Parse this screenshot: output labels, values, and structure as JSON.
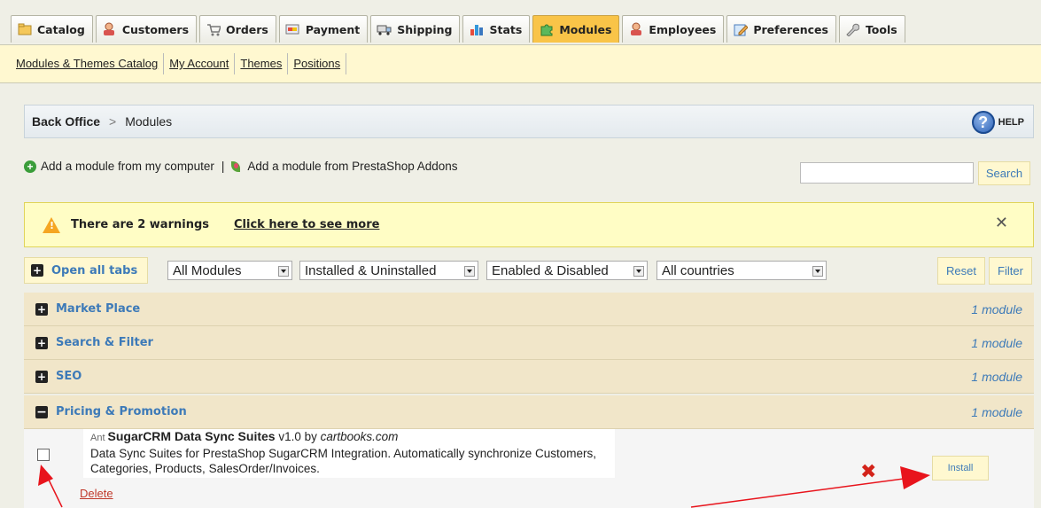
{
  "tabs": [
    {
      "label": "Catalog",
      "icon": "folder-icon"
    },
    {
      "label": "Customers",
      "icon": "customer-icon"
    },
    {
      "label": "Orders",
      "icon": "cart-icon"
    },
    {
      "label": "Payment",
      "icon": "payment-icon"
    },
    {
      "label": "Shipping",
      "icon": "truck-icon"
    },
    {
      "label": "Stats",
      "icon": "bar-chart-icon"
    },
    {
      "label": "Modules",
      "icon": "puzzle-icon",
      "active": true
    },
    {
      "label": "Employees",
      "icon": "employee-icon"
    },
    {
      "label": "Preferences",
      "icon": "pencil-icon"
    },
    {
      "label": "Tools",
      "icon": "wrench-icon"
    }
  ],
  "subnav": [
    "Modules & Themes Catalog",
    "My Account",
    "Themes",
    "Positions"
  ],
  "breadcrumb": {
    "root": "Back Office",
    "separator": ">",
    "current": "Modules",
    "help": "HELP"
  },
  "actions": {
    "add_computer": "Add a module from my computer",
    "pipe": "|",
    "add_addons": "Add a module from PrestaShop Addons"
  },
  "search": {
    "value": "",
    "button": "Search"
  },
  "warning": {
    "text": "There are 2 warnings",
    "link": "Click here to see more",
    "close": "✕"
  },
  "filters": {
    "open_all": "Open all tabs",
    "type": "All Modules",
    "install": "Installed & Uninstalled",
    "status": "Enabled & Disabled",
    "country": "All countries",
    "reset": "Reset",
    "filter": "Filter"
  },
  "categories": [
    {
      "name": "Market Place",
      "count": "1 module",
      "expanded": false
    },
    {
      "name": "Search & Filter",
      "count": "1 module",
      "expanded": false
    },
    {
      "name": "SEO",
      "count": "1 module",
      "expanded": false
    },
    {
      "name": "Pricing & Promotion",
      "count": "1 module",
      "expanded": true
    }
  ],
  "module": {
    "logo": "Ant",
    "name": "SugarCRM Data Sync Suites",
    "version": "v1.0 by",
    "author": "cartbooks.com",
    "description": "Data Sync Suites for PrestaShop SugarCRM Integration. Automatically synchronize Customers, Categories, Products, SalesOrder/Invoices.",
    "delete": "Delete",
    "install": "Install",
    "x_mark": "✖"
  },
  "colors": {
    "accent": "#3d7ab8",
    "active_tab": "#f9c448",
    "warning_bg": "#fffdc5",
    "annotation": "#e8141c"
  }
}
